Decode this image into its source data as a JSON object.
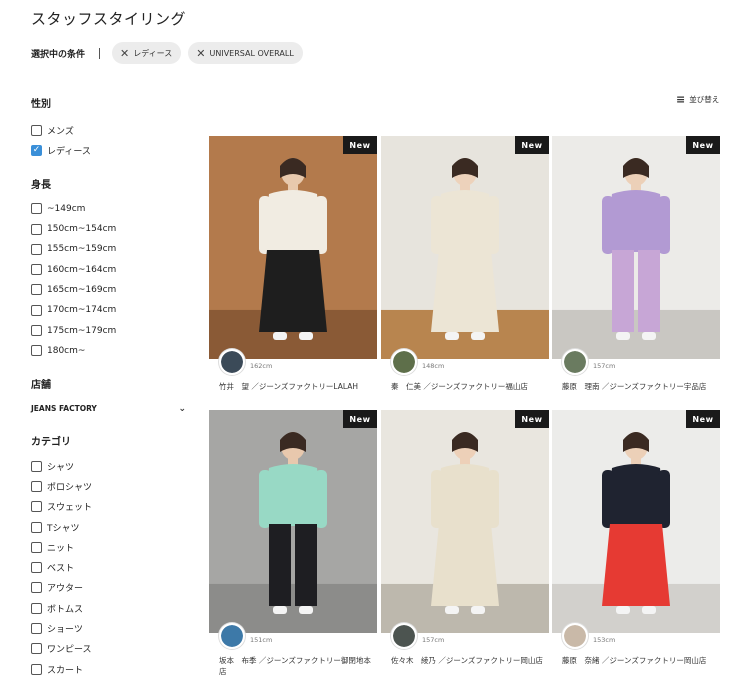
{
  "page": {
    "title": "スタッフスタイリング"
  },
  "conditions": {
    "label": "選択中の条件",
    "chips": [
      "レディース",
      "UNIVERSAL OVERALL"
    ]
  },
  "sort": {
    "label": "並び替え"
  },
  "filters": {
    "gender": {
      "title": "性別",
      "options": [
        {
          "label": "メンズ",
          "checked": false
        },
        {
          "label": "レディース",
          "checked": true
        }
      ]
    },
    "height": {
      "title": "身長",
      "options": [
        {
          "label": "~149cm"
        },
        {
          "label": "150cm~154cm"
        },
        {
          "label": "155cm~159cm"
        },
        {
          "label": "160cm~164cm"
        },
        {
          "label": "165cm~169cm"
        },
        {
          "label": "170cm~174cm"
        },
        {
          "label": "175cm~179cm"
        },
        {
          "label": "180cm~"
        }
      ]
    },
    "store": {
      "title": "店舗",
      "selected": "JEANS FACTORY"
    },
    "category": {
      "title": "カテゴリ",
      "options": [
        {
          "label": "シャツ"
        },
        {
          "label": "ポロシャツ"
        },
        {
          "label": "スウェット"
        },
        {
          "label": "Tシャツ"
        },
        {
          "label": "ニット"
        },
        {
          "label": "ベスト"
        },
        {
          "label": "アウター"
        },
        {
          "label": "ボトムス"
        },
        {
          "label": "ショーツ"
        },
        {
          "label": "ワンピース"
        },
        {
          "label": "スカート"
        }
      ]
    }
  },
  "cards": [
    {
      "badge": "New",
      "height": "162cm",
      "staff": "竹井　望 ／ジーンズファクトリーLALAH",
      "bg": "#b37a4c",
      "floor": "#8a5a36",
      "top": "#f1ece2",
      "bottom": "#1e1e1e",
      "skin": "#e8c9ad",
      "avatar": "#3b4a58"
    },
    {
      "badge": "New",
      "height": "148cm",
      "staff": "秦　仁美 ／ジーンズファクトリー福山店",
      "bg": "#e7e4dd",
      "floor": "#b8854f",
      "top": "#ece5d5",
      "bottom": "#ece5d5",
      "skin": "#edd2bb",
      "avatar": "#5e6f4a"
    },
    {
      "badge": "New",
      "height": "157cm",
      "staff": "藤原　理南 ／ジーンズファクトリー宇品店",
      "bg": "#ecebe8",
      "floor": "#c9c7c2",
      "top": "#b29ad3",
      "bottom": "#c7a6d6",
      "skin": "#ecd0b8",
      "avatar": "#6a7b60"
    },
    {
      "badge": "New",
      "height": "151cm",
      "staff": "坂本　布季 ／ジーンズファクトリー御閉地本店",
      "bg": "#a6a6a4",
      "floor": "#8c8c8a",
      "top": "#98d9c5",
      "bottom": "#1e1e22",
      "skin": "#e8c8ad",
      "avatar": "#3d79a8"
    },
    {
      "badge": "New",
      "height": "157cm",
      "staff": "佐々木　綾乃 ／ジーンズファクトリー岡山店",
      "bg": "#e9e6df",
      "floor": "#bdb8ad",
      "top": "#e8e0cc",
      "bottom": "#e8e0cc",
      "skin": "#edd0b8",
      "avatar": "#4c5450"
    },
    {
      "badge": "New",
      "height": "153cm",
      "staff": "藤原　奈緒 ／ジーンズファクトリー岡山店",
      "bg": "#ececea",
      "floor": "#d2d0cc",
      "top": "#1f2330",
      "bottom": "#e63a33",
      "skin": "#ecd0b8",
      "avatar": "#c9b9a8"
    }
  ]
}
